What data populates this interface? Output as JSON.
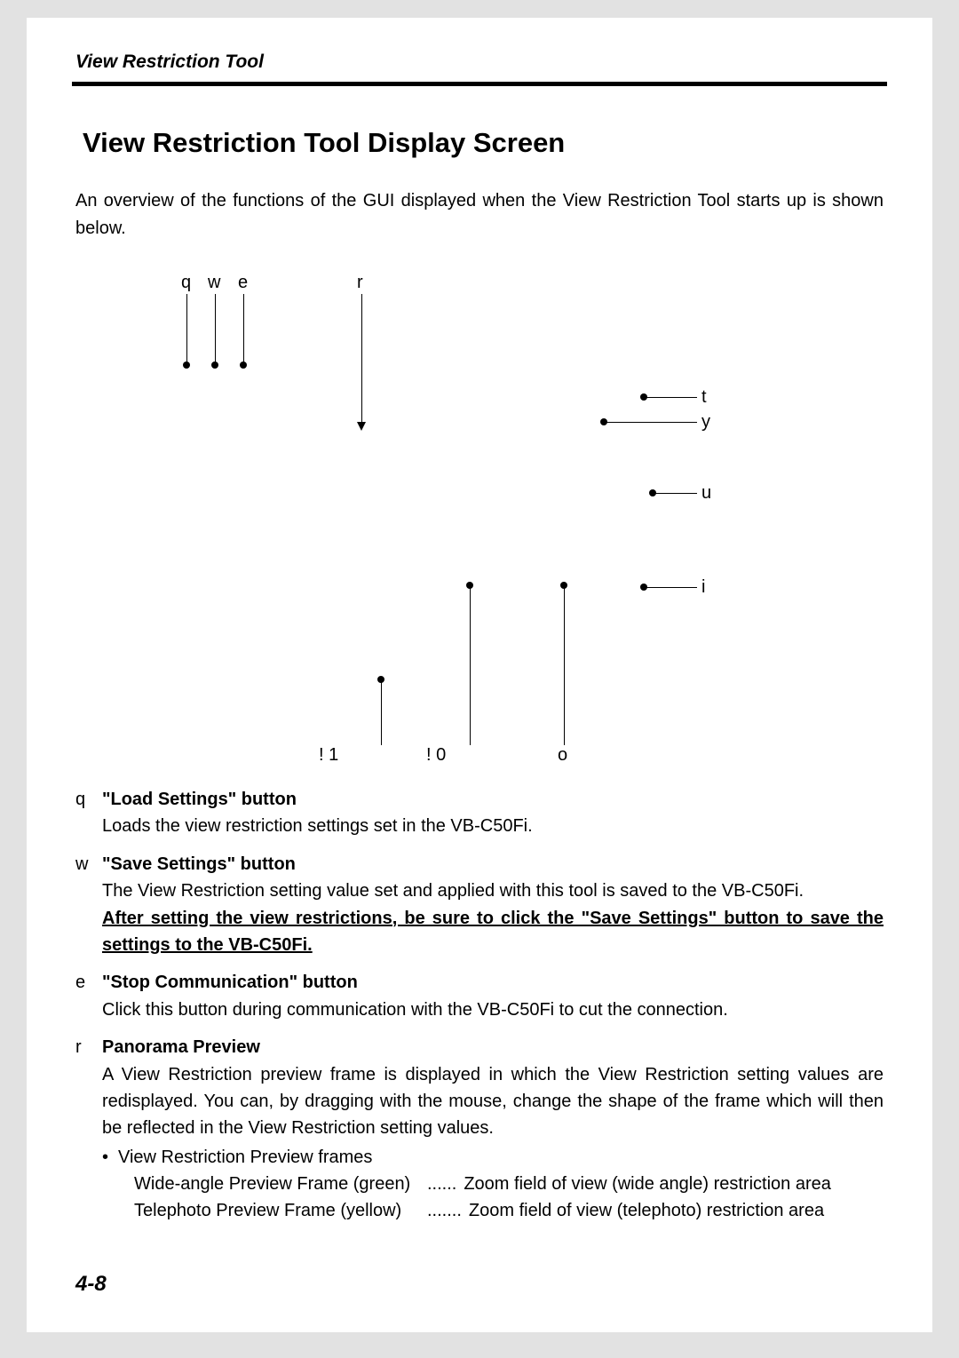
{
  "header": {
    "title": "View Restriction Tool"
  },
  "section": {
    "title": "View Restriction Tool Display Screen",
    "intro": "An overview of the functions of the GUI displayed when the View Restriction Tool starts up is shown below."
  },
  "labels": {
    "q": "q",
    "w": "w",
    "e": "e",
    "r": "r",
    "t": "t",
    "y": "y",
    "u": "u",
    "i": "i",
    "o": "o",
    "c0": "! 0",
    "c1": "! 1"
  },
  "defs": {
    "q": {
      "key": "q",
      "title": "\"Load Settings\" button",
      "body": "Loads the view restriction settings set in the VB-C50Fi."
    },
    "w": {
      "key": "w",
      "title": "\"Save Settings\" button",
      "body": "The View Restriction setting value set and applied with this tool is saved to the VB-C50Fi.",
      "emph": "After setting the view restrictions, be sure to click the \"Save Settings\" button to save the settings to the VB-C50Fi."
    },
    "e": {
      "key": "e",
      "title": "\"Stop Communication\" button",
      "body": "Click this button during communication with the VB-C50Fi to cut the connection."
    },
    "r": {
      "key": "r",
      "title": "Panorama Preview",
      "body": "A View Restriction preview frame is displayed in which the View Restriction setting values are redisplayed. You can, by dragging with the mouse, change the shape of the frame which will then be reflected in the View Restriction setting values.",
      "sub_title": "View Restriction Preview frames",
      "frame1_l": "Wide-angle Preview Frame (green)",
      "frame1_d": "......",
      "frame1_r": "Zoom field of view (wide angle) restriction area",
      "frame2_l": "Telephoto Preview Frame (yellow)",
      "frame2_d": ".......",
      "frame2_r": "Zoom field of view (telephoto) restriction area"
    }
  },
  "pageNumber": "4-8"
}
